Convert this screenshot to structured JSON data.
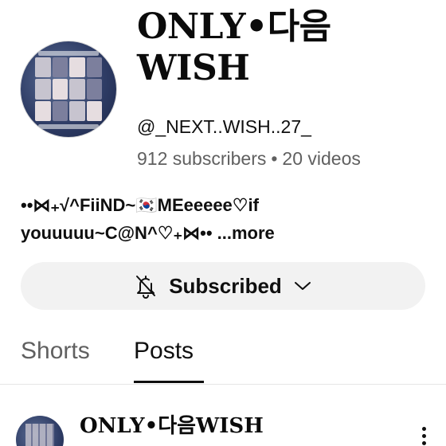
{
  "channel": {
    "name": "ONLY•다음 WISH",
    "handle": "@_NEXT..WISH..27_",
    "subscribers": "912 subscribers",
    "separator": "•",
    "videos": "20 videos",
    "description": "••⋈₊√^FiiND~🇰🇷MEeeeee♡if youuuuu~C@N^♡₊⋈•• ",
    "more_label": "...more"
  },
  "subscribe_button": {
    "label": "Subscribed",
    "bell_icon": "bell-off-icon",
    "dropdown_icon": "chevron-down-icon"
  },
  "tabs": [
    {
      "label": "Shorts",
      "active": false
    },
    {
      "label": "Posts",
      "active": true
    }
  ],
  "post": {
    "author": "ONLY•다음WISH",
    "menu_icon": "more-vert-icon"
  },
  "colors": {
    "background": "#ffffff",
    "text_primary": "#0f0f0f",
    "text_secondary": "#606060",
    "button_bg": "#f2f2f2",
    "avatar_blue": "#2f3d66"
  }
}
